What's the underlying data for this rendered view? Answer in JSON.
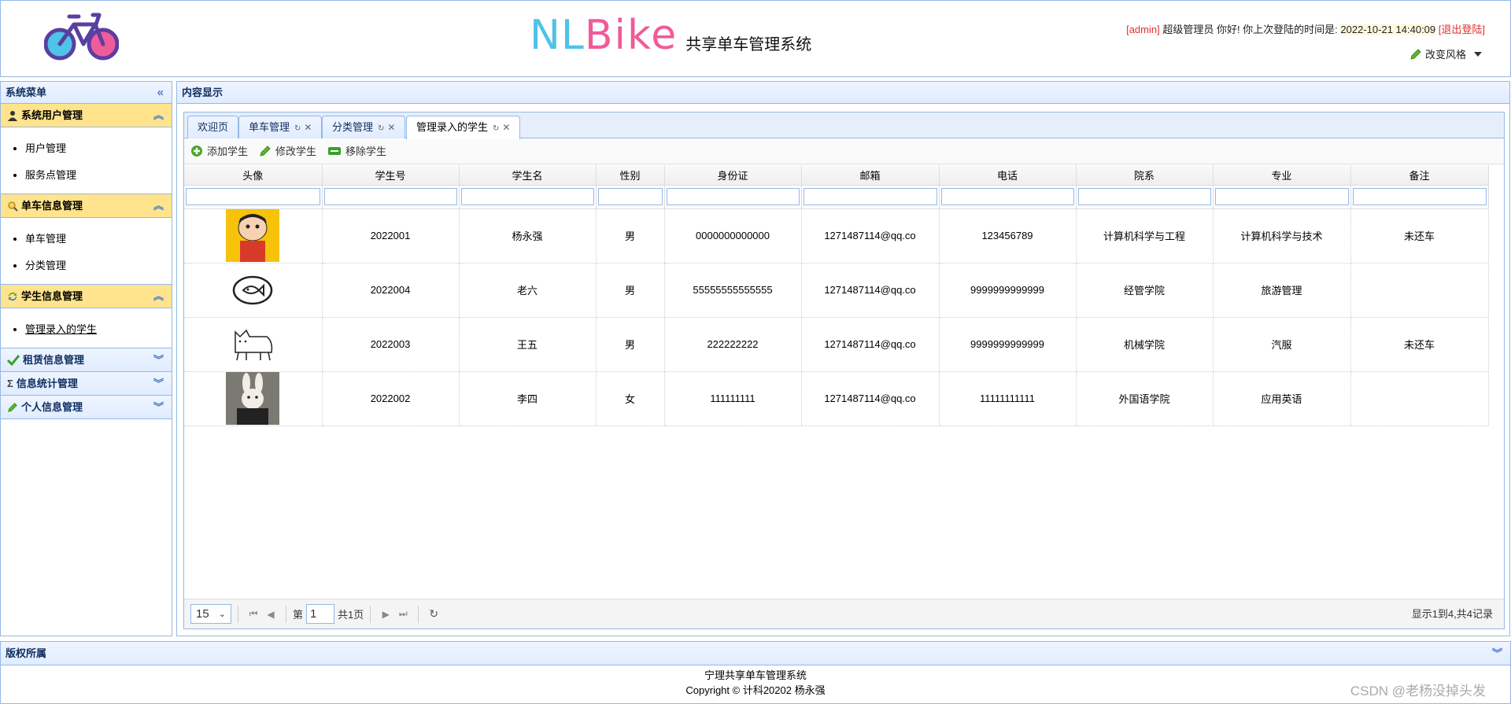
{
  "header": {
    "brand_nl": "NL",
    "brand_bike": "Bike",
    "brand_sub": "共享单车管理系统",
    "user_role": "[admin]",
    "greeting": "超级管理员 你好! 你上次登陆的时间是:",
    "last_login": "2022-10-21 14:40:09",
    "logout": "[退出登陆]",
    "change_style": "改变风格"
  },
  "sidebar": {
    "title": "系统菜单",
    "groups": [
      {
        "label": "系统用户管理",
        "icon": "user-icon",
        "items": [
          "用户管理",
          "服务点管理"
        ]
      },
      {
        "label": "单车信息管理",
        "icon": "magnifier-icon",
        "items": [
          "单车管理",
          "分类管理"
        ]
      },
      {
        "label": "学生信息管理",
        "icon": "refresh-icon",
        "items": [
          "管理录入的学生"
        ]
      },
      {
        "label": "租赁信息管理",
        "icon": "checkmark-icon"
      },
      {
        "label": "信息统计管理",
        "icon": "sigma-icon"
      },
      {
        "label": "个人信息管理",
        "icon": "pencil-icon"
      }
    ]
  },
  "content": {
    "title": "内容显示",
    "tabs": [
      "欢迎页",
      "单车管理",
      "分类管理",
      "管理录入的学生"
    ],
    "toolbar": {
      "add": "添加学生",
      "edit": "修改学生",
      "remove": "移除学生"
    },
    "columns": [
      "头像",
      "学生号",
      "学生名",
      "性别",
      "身份证",
      "邮箱",
      "电话",
      "院系",
      "专业",
      "备注"
    ],
    "rows": [
      {
        "avatar": "cartoon-boy-avatar",
        "id": "2022001",
        "name": "杨永强",
        "gender": "男",
        "idcard": "0000000000000",
        "email": "1271487114@qq.co",
        "phone": "123456789",
        "dept": "计算机科学与工程",
        "major": "计算机科学与技术",
        "note": "未还车"
      },
      {
        "avatar": "fish-doodle-avatar",
        "id": "2022004",
        "name": "老六",
        "gender": "男",
        "idcard": "55555555555555",
        "email": "1271487114@qq.co",
        "phone": "9999999999999",
        "dept": "经管学院",
        "major": "旅游管理",
        "note": ""
      },
      {
        "avatar": "cat-doodle-avatar",
        "id": "2022003",
        "name": "王五",
        "gender": "男",
        "idcard": "222222222",
        "email": "1271487114@qq.co",
        "phone": "9999999999999",
        "dept": "机械学院",
        "major": "汽服",
        "note": "未还车"
      },
      {
        "avatar": "rabbit-photo-avatar",
        "id": "2022002",
        "name": "李四",
        "gender": "女",
        "idcard": "111111111",
        "email": "1271487114@qq.co",
        "phone": "11111111111",
        "dept": "外国语学院",
        "major": "应用英语",
        "note": ""
      }
    ],
    "pager": {
      "page_size": "15",
      "page_prefix": "第",
      "page_num": "1",
      "page_total": "共1页",
      "summary": "显示1到4,共4记录"
    }
  },
  "footer": {
    "title": "版权所属",
    "line1": "宁理共享单车管理系统",
    "line2": "Copyright © 计科20202 杨永强"
  },
  "watermark": "CSDN @老杨没掉头发"
}
